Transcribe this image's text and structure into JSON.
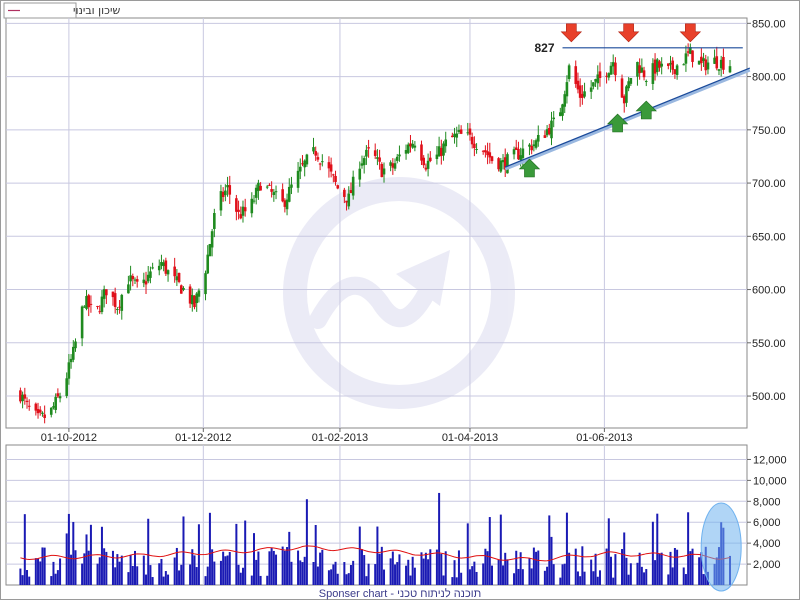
{
  "legend": {
    "label": "שיכון ובינוי",
    "color": "#b03060"
  },
  "footer": "Sponser chart - תוכנה לניתוח טכני",
  "watermark_icon": "trend-arrow-logo-icon",
  "colors": {
    "up": "#1f8a1f",
    "down": "#e0101a",
    "volume": "#1a1ab4",
    "volume_ma": "#e01010",
    "trendline": "#1a4a9a",
    "grid": "#c8c8e0",
    "arrow_down": "#e8402a",
    "arrow_up": "#3a9a3a",
    "highlight": "#6fb2ef"
  },
  "chart_data": [
    {
      "type": "candlestick",
      "title": "",
      "xlabel": "",
      "ylabel": "",
      "ylim": [
        470,
        855
      ],
      "y_ticks": [
        "500.00",
        "550.00",
        "600.00",
        "650.00",
        "700.00",
        "750.00",
        "800.00",
        "850.00"
      ],
      "x_ticks": [
        "01-10-2012",
        "01-12-2012",
        "01-02-2013",
        "01-04-2013",
        "01-06-2013"
      ],
      "grid": true,
      "x_range": [
        "2012-09-07",
        "2013-07-28"
      ],
      "resistance": {
        "value": 827,
        "label": "827",
        "from": "2013-05-13",
        "to": "2013-07-27"
      },
      "support_line": {
        "from": {
          "date": "2013-04-17",
          "value": 715
        },
        "to": {
          "date": "2013-07-27",
          "value": 808
        }
      },
      "arrows_down": [
        "2013-05-17",
        "2013-06-12",
        "2013-07-10"
      ],
      "arrows_up": [
        "2013-04-28",
        "2013-06-07",
        "2013-06-20"
      ],
      "keypoints": [
        [
          "2012-09-07",
          510
        ],
        [
          "2012-09-12",
          490
        ],
        [
          "2012-09-17",
          478
        ],
        [
          "2012-09-22",
          482
        ],
        [
          "2012-09-28",
          505
        ],
        [
          "2012-10-03",
          540
        ],
        [
          "2012-10-08",
          590
        ],
        [
          "2012-10-13",
          575
        ],
        [
          "2012-10-18",
          600
        ],
        [
          "2012-10-23",
          585
        ],
        [
          "2012-10-28",
          610
        ],
        [
          "2012-11-02",
          600
        ],
        [
          "2012-11-07",
          615
        ],
        [
          "2012-11-12",
          625
        ],
        [
          "2012-11-17",
          610
        ],
        [
          "2012-11-22",
          600
        ],
        [
          "2012-11-27",
          585
        ],
        [
          "2012-12-02",
          620
        ],
        [
          "2012-12-07",
          680
        ],
        [
          "2012-12-12",
          695
        ],
        [
          "2012-12-17",
          670
        ],
        [
          "2012-12-22",
          675
        ],
        [
          "2012-12-27",
          700
        ],
        [
          "2013-01-01",
          690
        ],
        [
          "2013-01-06",
          680
        ],
        [
          "2013-01-11",
          700
        ],
        [
          "2013-01-16",
          718
        ],
        [
          "2013-01-21",
          730
        ],
        [
          "2013-01-26",
          715
        ],
        [
          "2013-01-31",
          695
        ],
        [
          "2013-02-05",
          685
        ],
        [
          "2013-02-10",
          720
        ],
        [
          "2013-02-15",
          730
        ],
        [
          "2013-02-20",
          712
        ],
        [
          "2013-02-25",
          715
        ],
        [
          "2013-03-02",
          732
        ],
        [
          "2013-03-07",
          740
        ],
        [
          "2013-03-12",
          718
        ],
        [
          "2013-03-17",
          725
        ],
        [
          "2013-03-22",
          740
        ],
        [
          "2013-03-27",
          745
        ],
        [
          "2013-04-01",
          742
        ],
        [
          "2013-04-06",
          735
        ],
        [
          "2013-04-11",
          722
        ],
        [
          "2013-04-16",
          718
        ],
        [
          "2013-04-21",
          725
        ],
        [
          "2013-04-26",
          732
        ],
        [
          "2013-05-01",
          738
        ],
        [
          "2013-05-06",
          750
        ],
        [
          "2013-05-11",
          760
        ],
        [
          "2013-05-16",
          808
        ],
        [
          "2013-05-21",
          782
        ],
        [
          "2013-05-26",
          790
        ],
        [
          "2013-05-31",
          800
        ],
        [
          "2013-06-05",
          815
        ],
        [
          "2013-06-10",
          778
        ],
        [
          "2013-06-15",
          815
        ],
        [
          "2013-06-20",
          800
        ],
        [
          "2013-06-25",
          810
        ],
        [
          "2013-06-30",
          805
        ],
        [
          "2013-07-05",
          812
        ],
        [
          "2013-07-10",
          822
        ],
        [
          "2013-07-15",
          810
        ],
        [
          "2013-07-20",
          815
        ],
        [
          "2013-07-27",
          812
        ]
      ]
    },
    {
      "type": "bar",
      "title": "",
      "ylim": [
        0,
        13000
      ],
      "y_ticks": [
        "2,000",
        "4,000",
        "6,000",
        "8,000",
        "10,000",
        "12,000"
      ],
      "series": [
        {
          "role": "volume",
          "summary": "daily volume mostly 1,000-4,000 with spikes near 8,000-12,800",
          "peaks": [
            [
              "2013-03-18",
              8800
            ],
            [
              "2013-04-19",
              12800
            ],
            [
              "2013-01-17",
              8200
            ],
            [
              "2012-12-22",
              8000
            ],
            [
              "2013-07-24",
              6000
            ]
          ]
        },
        {
          "role": "moving_average",
          "approx_values": [
            [
              "2012-09-10",
              2600
            ],
            [
              "2012-11-01",
              2800
            ],
            [
              "2012-12-15",
              3200
            ],
            [
              "2013-01-15",
              3600
            ],
            [
              "2013-02-15",
              3300
            ],
            [
              "2013-04-01",
              2700
            ],
            [
              "2013-05-01",
              2400
            ],
            [
              "2013-06-01",
              3000
            ],
            [
              "2013-07-10",
              2800
            ],
            [
              "2013-07-27",
              2600
            ]
          ]
        }
      ],
      "highlight": {
        "shape": "ellipse",
        "around": "2013-07-24"
      }
    }
  ]
}
